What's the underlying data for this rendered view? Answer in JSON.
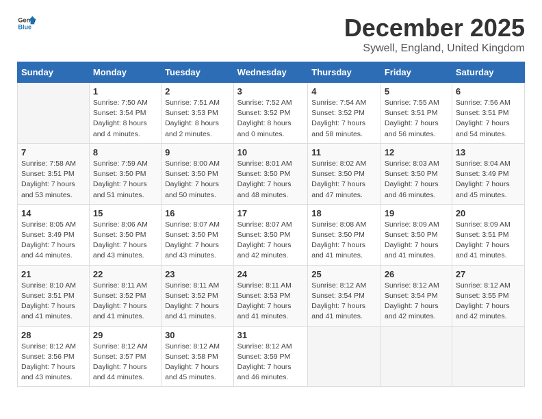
{
  "logo": {
    "general": "General",
    "blue": "Blue"
  },
  "title": "December 2025",
  "location": "Sywell, England, United Kingdom",
  "days_of_week": [
    "Sunday",
    "Monday",
    "Tuesday",
    "Wednesday",
    "Thursday",
    "Friday",
    "Saturday"
  ],
  "weeks": [
    [
      {
        "day": "",
        "info": ""
      },
      {
        "day": "1",
        "info": "Sunrise: 7:50 AM\nSunset: 3:54 PM\nDaylight: 8 hours\nand 4 minutes."
      },
      {
        "day": "2",
        "info": "Sunrise: 7:51 AM\nSunset: 3:53 PM\nDaylight: 8 hours\nand 2 minutes."
      },
      {
        "day": "3",
        "info": "Sunrise: 7:52 AM\nSunset: 3:52 PM\nDaylight: 8 hours\nand 0 minutes."
      },
      {
        "day": "4",
        "info": "Sunrise: 7:54 AM\nSunset: 3:52 PM\nDaylight: 7 hours\nand 58 minutes."
      },
      {
        "day": "5",
        "info": "Sunrise: 7:55 AM\nSunset: 3:51 PM\nDaylight: 7 hours\nand 56 minutes."
      },
      {
        "day": "6",
        "info": "Sunrise: 7:56 AM\nSunset: 3:51 PM\nDaylight: 7 hours\nand 54 minutes."
      }
    ],
    [
      {
        "day": "7",
        "info": "Sunrise: 7:58 AM\nSunset: 3:51 PM\nDaylight: 7 hours\nand 53 minutes."
      },
      {
        "day": "8",
        "info": "Sunrise: 7:59 AM\nSunset: 3:50 PM\nDaylight: 7 hours\nand 51 minutes."
      },
      {
        "day": "9",
        "info": "Sunrise: 8:00 AM\nSunset: 3:50 PM\nDaylight: 7 hours\nand 50 minutes."
      },
      {
        "day": "10",
        "info": "Sunrise: 8:01 AM\nSunset: 3:50 PM\nDaylight: 7 hours\nand 48 minutes."
      },
      {
        "day": "11",
        "info": "Sunrise: 8:02 AM\nSunset: 3:50 PM\nDaylight: 7 hours\nand 47 minutes."
      },
      {
        "day": "12",
        "info": "Sunrise: 8:03 AM\nSunset: 3:50 PM\nDaylight: 7 hours\nand 46 minutes."
      },
      {
        "day": "13",
        "info": "Sunrise: 8:04 AM\nSunset: 3:49 PM\nDaylight: 7 hours\nand 45 minutes."
      }
    ],
    [
      {
        "day": "14",
        "info": "Sunrise: 8:05 AM\nSunset: 3:49 PM\nDaylight: 7 hours\nand 44 minutes."
      },
      {
        "day": "15",
        "info": "Sunrise: 8:06 AM\nSunset: 3:50 PM\nDaylight: 7 hours\nand 43 minutes."
      },
      {
        "day": "16",
        "info": "Sunrise: 8:07 AM\nSunset: 3:50 PM\nDaylight: 7 hours\nand 43 minutes."
      },
      {
        "day": "17",
        "info": "Sunrise: 8:07 AM\nSunset: 3:50 PM\nDaylight: 7 hours\nand 42 minutes."
      },
      {
        "day": "18",
        "info": "Sunrise: 8:08 AM\nSunset: 3:50 PM\nDaylight: 7 hours\nand 41 minutes."
      },
      {
        "day": "19",
        "info": "Sunrise: 8:09 AM\nSunset: 3:50 PM\nDaylight: 7 hours\nand 41 minutes."
      },
      {
        "day": "20",
        "info": "Sunrise: 8:09 AM\nSunset: 3:51 PM\nDaylight: 7 hours\nand 41 minutes."
      }
    ],
    [
      {
        "day": "21",
        "info": "Sunrise: 8:10 AM\nSunset: 3:51 PM\nDaylight: 7 hours\nand 41 minutes."
      },
      {
        "day": "22",
        "info": "Sunrise: 8:11 AM\nSunset: 3:52 PM\nDaylight: 7 hours\nand 41 minutes."
      },
      {
        "day": "23",
        "info": "Sunrise: 8:11 AM\nSunset: 3:52 PM\nDaylight: 7 hours\nand 41 minutes."
      },
      {
        "day": "24",
        "info": "Sunrise: 8:11 AM\nSunset: 3:53 PM\nDaylight: 7 hours\nand 41 minutes."
      },
      {
        "day": "25",
        "info": "Sunrise: 8:12 AM\nSunset: 3:54 PM\nDaylight: 7 hours\nand 41 minutes."
      },
      {
        "day": "26",
        "info": "Sunrise: 8:12 AM\nSunset: 3:54 PM\nDaylight: 7 hours\nand 42 minutes."
      },
      {
        "day": "27",
        "info": "Sunrise: 8:12 AM\nSunset: 3:55 PM\nDaylight: 7 hours\nand 42 minutes."
      }
    ],
    [
      {
        "day": "28",
        "info": "Sunrise: 8:12 AM\nSunset: 3:56 PM\nDaylight: 7 hours\nand 43 minutes."
      },
      {
        "day": "29",
        "info": "Sunrise: 8:12 AM\nSunset: 3:57 PM\nDaylight: 7 hours\nand 44 minutes."
      },
      {
        "day": "30",
        "info": "Sunrise: 8:12 AM\nSunset: 3:58 PM\nDaylight: 7 hours\nand 45 minutes."
      },
      {
        "day": "31",
        "info": "Sunrise: 8:12 AM\nSunset: 3:59 PM\nDaylight: 7 hours\nand 46 minutes."
      },
      {
        "day": "",
        "info": ""
      },
      {
        "day": "",
        "info": ""
      },
      {
        "day": "",
        "info": ""
      }
    ]
  ]
}
